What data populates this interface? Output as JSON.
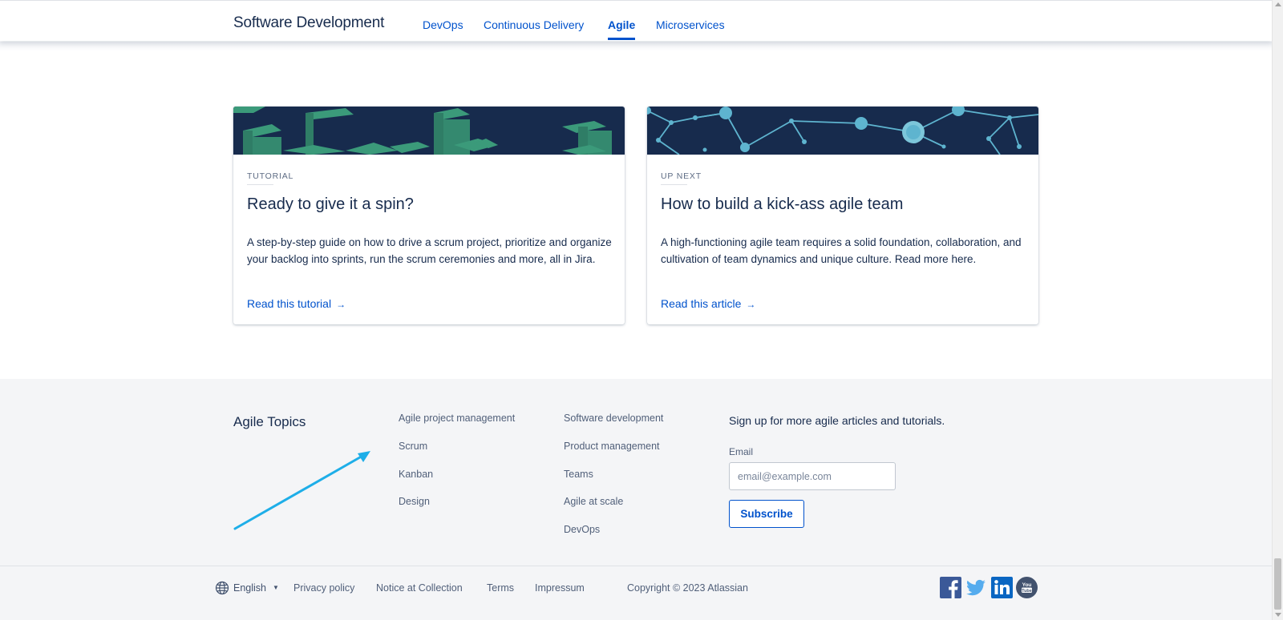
{
  "nav": {
    "brand": "Software Development",
    "links": [
      {
        "label": "DevOps",
        "active": false
      },
      {
        "label": "Continuous Delivery",
        "active": false
      },
      {
        "label": "Agile",
        "active": true
      },
      {
        "label": "Microservices",
        "active": false
      }
    ]
  },
  "cards": [
    {
      "eyebrow": "TUTORIAL",
      "title": "Ready to give it a spin?",
      "description": "A step-by-step guide on how to drive a scrum project, prioritize and organize your backlog into sprints, run the scrum ceremonies and more, all in Jira.",
      "link": "Read this tutorial",
      "arrow": "→"
    },
    {
      "eyebrow": "UP NEXT",
      "title": "How to build a kick-ass agile team",
      "description": "A high-functioning agile team requires a solid foundation, collaboration, and cultivation of team dynamics and unique culture. Read more here.",
      "link": "Read this article",
      "arrow": "→"
    }
  ],
  "footer": {
    "topics_title": "Agile Topics",
    "column1": [
      "Agile project management",
      "Scrum",
      "Kanban",
      "Design"
    ],
    "column2": [
      "Software development",
      "Product management",
      "Teams",
      "Agile at scale",
      "DevOps"
    ],
    "signup_text": "Sign up for more agile articles and tutorials.",
    "email_label": "Email",
    "email_placeholder": "email@example.com",
    "subscribe_label": "Subscribe"
  },
  "bottom_bar": {
    "language": "English",
    "caret": "▼",
    "links": [
      "Privacy policy",
      "Notice at Collection",
      "Terms",
      "Impressum"
    ],
    "copyright": "Copyright © 2023 Atlassian",
    "social_icons": [
      "facebook-icon",
      "twitter-icon",
      "linkedin-icon",
      "youtube-icon"
    ]
  },
  "colors": {
    "link_blue": "#0052cc",
    "navy": "#172b4d",
    "footer_bg": "#f4f5f7",
    "banner_green": "#3b9a7a",
    "banner_network": "#5eb4cf",
    "annotation_arrow": "#1eaee8",
    "facebook": "#3b5998",
    "twitter": "#55acee",
    "linkedin": "#0a66c2",
    "youtube": "#42526e"
  }
}
